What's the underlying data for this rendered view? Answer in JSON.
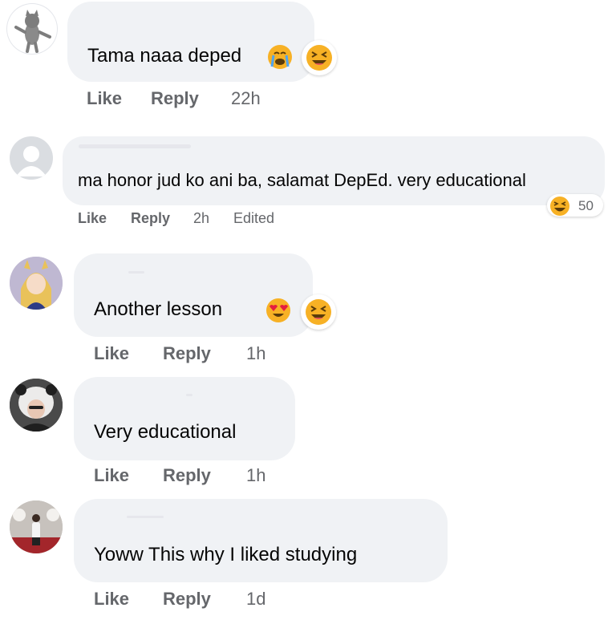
{
  "comments": [
    {
      "text": "Tama naaa deped",
      "reactions": [
        "crying-face-emoji",
        "laughing-face-emoji"
      ],
      "actions": {
        "like": "Like",
        "reply": "Reply",
        "time": "22h"
      }
    },
    {
      "text": "ma honor jud ko ani ba, salamat DepEd. very educational",
      "reactions_pill": {
        "icon": "laughing-face-emoji",
        "count": "50"
      },
      "actions": {
        "like": "Like",
        "reply": "Reply",
        "time": "2h",
        "edited": "Edited"
      }
    },
    {
      "text": "Another lesson",
      "reactions": [
        "heart-eyes-emoji",
        "laughing-face-emoji"
      ],
      "actions": {
        "like": "Like",
        "reply": "Reply",
        "time": "1h"
      }
    },
    {
      "text": "Very educational",
      "actions": {
        "like": "Like",
        "reply": "Reply",
        "time": "1h"
      }
    },
    {
      "text": "Yoww This why I liked studying",
      "actions": {
        "like": "Like",
        "reply": "Reply",
        "time": "1d"
      }
    }
  ],
  "colors": {
    "bubble": "#f0f2f5",
    "action_text": "#65676b",
    "emoji_yellow": "#f7b125",
    "heart_red": "#e41e3f"
  }
}
